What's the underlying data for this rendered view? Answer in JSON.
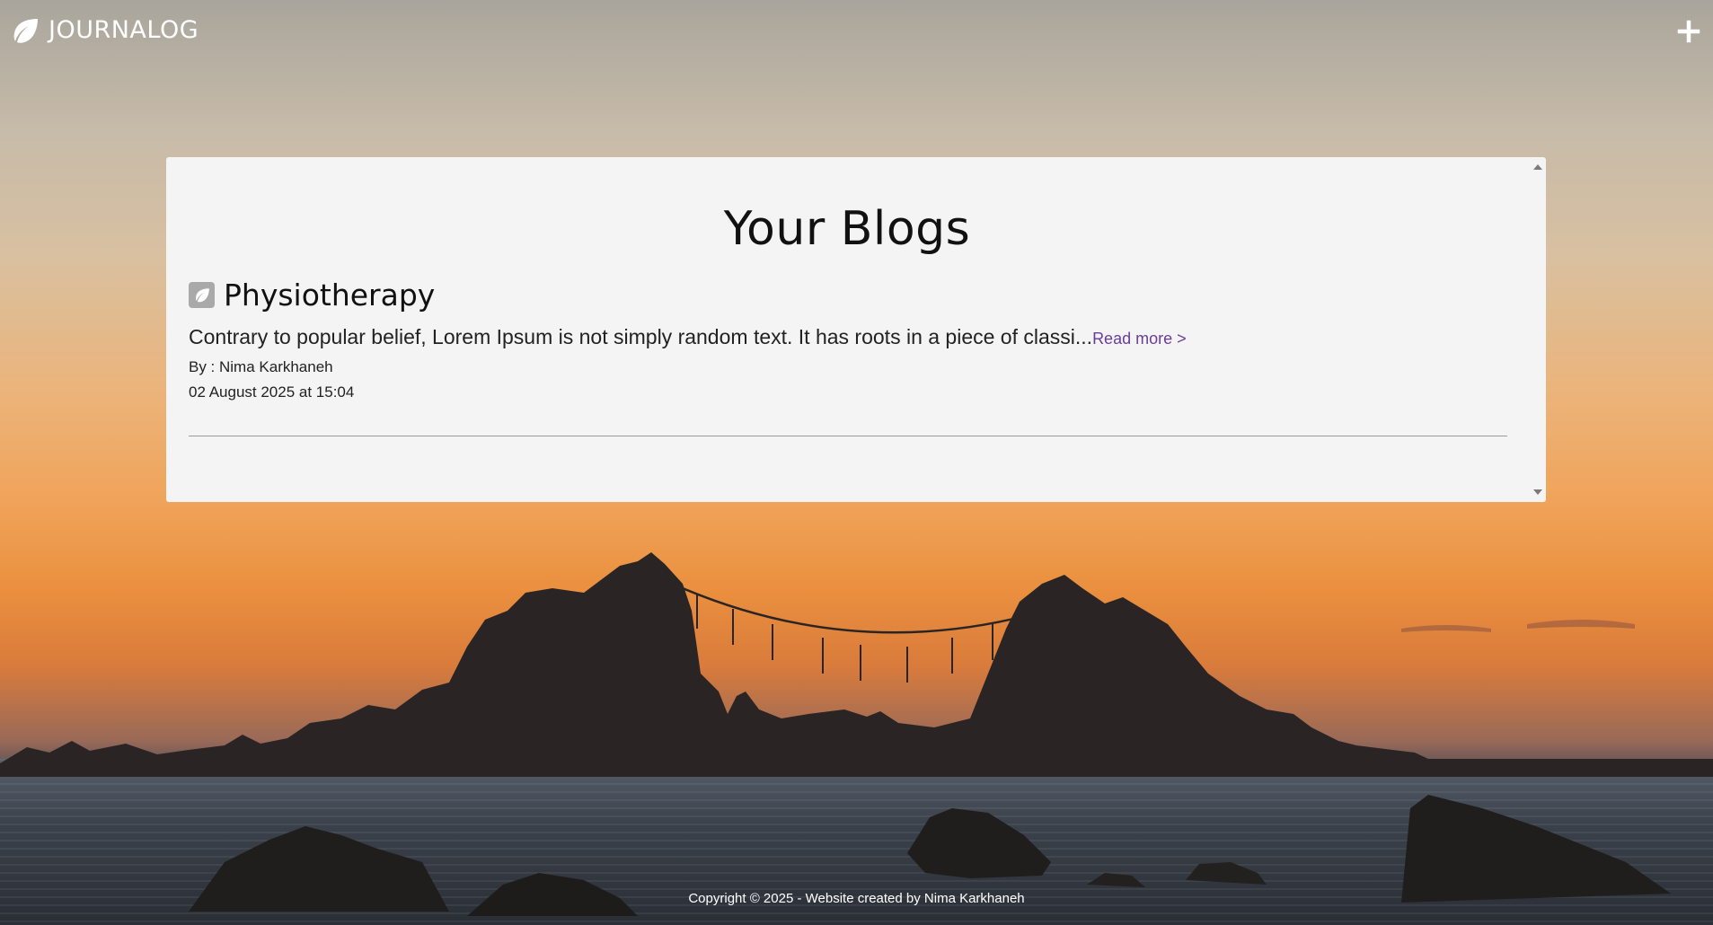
{
  "header": {
    "brand": "JOURNALOG",
    "brand_icon": "leaf-icon",
    "add_icon": "plus-icon"
  },
  "main": {
    "title": "Your Blogs",
    "posts": [
      {
        "icon": "leaf-icon",
        "title": "Physiotherapy",
        "excerpt": "Contrary to popular belief, Lorem Ipsum is not simply random text. It has roots in a piece of classi...",
        "read_more": "Read more >",
        "author": "By : Nima Karkhaneh",
        "date": "02 August 2025 at 15:04"
      }
    ]
  },
  "footer": {
    "text": "Copyright © 2025 - Website created by Nima Karkhaneh"
  },
  "colors": {
    "panel_bg": "#f4f4f4",
    "link": "#6a3d9a",
    "text": "#111111"
  }
}
